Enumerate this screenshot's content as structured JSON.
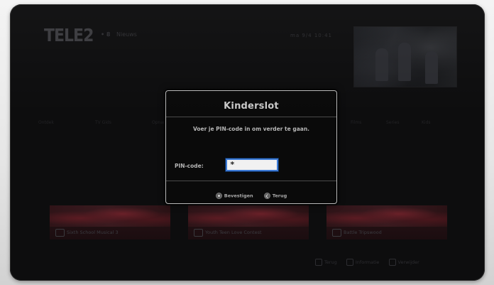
{
  "header": {
    "logo": "TELE2",
    "channel_number": "• 8",
    "channel_name": "Nieuws",
    "clock": "ma 9/4 10:41"
  },
  "menu": {
    "items": [
      "Ontdek",
      "TV Gids",
      "Opnames",
      "Films",
      "Series",
      "Kids",
      "Instellingen"
    ]
  },
  "thumbnails": [
    {
      "title": "Sixth School Musical 3"
    },
    {
      "title": "Youth Teen Love Contest"
    },
    {
      "title": "Battle Tripswood"
    }
  ],
  "footer_hints": [
    {
      "label": "Terug"
    },
    {
      "label": "Informatie"
    },
    {
      "label": "Verwijder"
    }
  ],
  "dialog": {
    "title": "Kinderslot",
    "message": "Voer je PIN-code in om verder te gaan.",
    "pin_label": "PIN-code:",
    "pin_value": "*",
    "confirm_label": "Bevestigen",
    "back_label": "Terug"
  },
  "colors": {
    "screen_background": "#0d0d0e",
    "dialog_border": "#b8b8b8",
    "input_focus": "#3d7bd6",
    "thumbnail_accent": "#5b1b22"
  },
  "icons": {
    "confirm": "ok-button-icon",
    "back": "back-button-icon"
  }
}
